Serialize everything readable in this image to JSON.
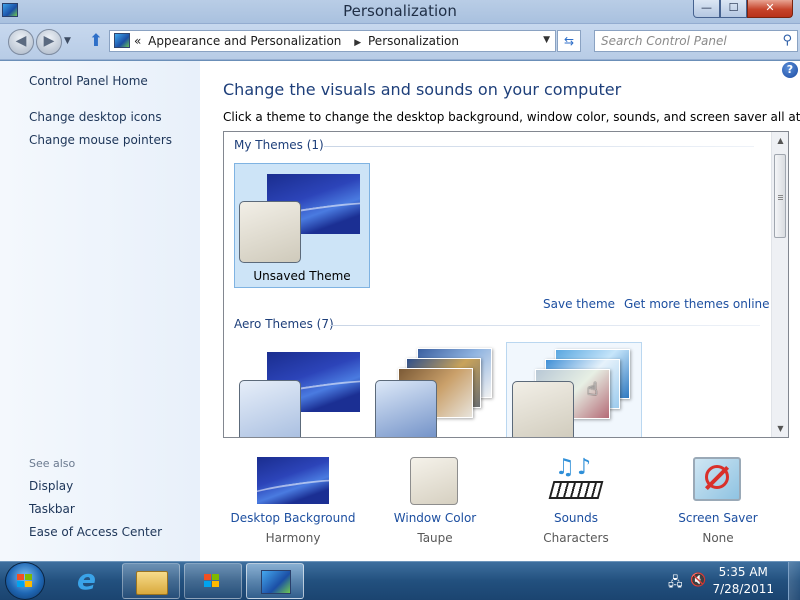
{
  "window": {
    "title": "Personalization",
    "min_label": "—",
    "max_label": "☐",
    "close_label": "✕"
  },
  "address": {
    "back_icon": "left-arrow-icon",
    "forward_icon": "right-arrow-icon",
    "overflow": "«",
    "crumbs": [
      "Appearance and Personalization",
      "Personalization"
    ],
    "separator": "▶",
    "search_placeholder": "Search Control Panel"
  },
  "sidebar": {
    "home": "Control Panel Home",
    "items": [
      "Change desktop icons",
      "Change mouse pointers"
    ],
    "see_also_title": "See also",
    "see_also": [
      "Display",
      "Taskbar",
      "Ease of Access Center"
    ]
  },
  "main": {
    "heading": "Change the visuals and sounds on your computer",
    "instructions": "Click a theme to change the desktop background, window color, sounds, and screen saver all at once.",
    "help": "?",
    "groups": {
      "my_themes": "My Themes (1)",
      "aero_themes": "Aero Themes (7)"
    },
    "unsaved_theme": "Unsaved Theme",
    "save_theme": "Save theme",
    "get_more": "Get more themes online"
  },
  "bottom": [
    {
      "label": "Desktop Background",
      "value": "Harmony"
    },
    {
      "label": "Window Color",
      "value": "Taupe"
    },
    {
      "label": "Sounds",
      "value": "Characters"
    },
    {
      "label": "Screen Saver",
      "value": "None"
    }
  ],
  "taskbar": {
    "time": "5:35 AM",
    "date": "7/28/2011"
  },
  "colors": {
    "link": "#1d4fa0",
    "heading": "#1e3f7a",
    "selected_bg": "#cde4f7"
  }
}
